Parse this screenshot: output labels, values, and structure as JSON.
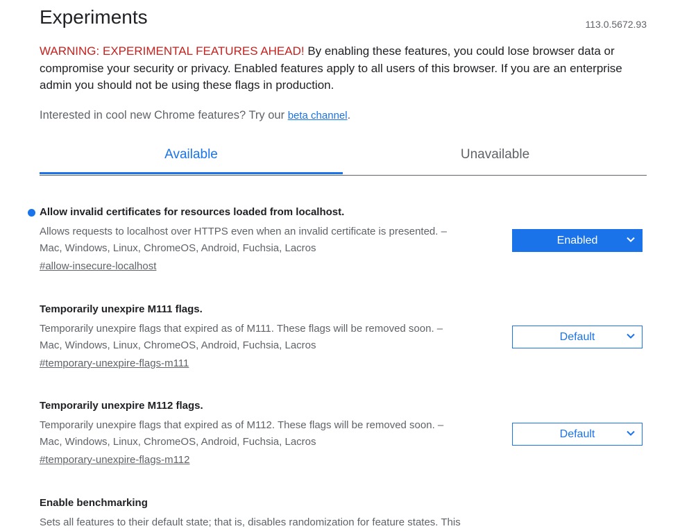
{
  "header": {
    "title": "Experiments",
    "version": "113.0.5672.93"
  },
  "warning": {
    "label": "WARNING: EXPERIMENTAL FEATURES AHEAD!",
    "text": " By enabling these features, you could lose browser data or compromise your security or privacy. Enabled features apply to all users of this browser. If you are an enterprise admin you should not be using these flags in production."
  },
  "promo": {
    "text": "Interested in cool new Chrome features? Try our ",
    "link": "beta channel",
    "suffix": "."
  },
  "tabs": [
    {
      "label": "Available",
      "active": true
    },
    {
      "label": "Unavailable",
      "active": false
    }
  ],
  "flags": [
    {
      "name": "Allow invalid certificates for resources loaded from localhost.",
      "description_line1": "Allows requests to localhost over HTTPS even when an invalid certificate is presented. –",
      "description_line2": "Mac, Windows, Linux, ChromeOS, Android, Fuchsia, Lacros",
      "link": "#allow-insecure-localhost",
      "value": "Enabled",
      "modified": true
    },
    {
      "name": "Temporarily unexpire M111 flags.",
      "description_line1": "Temporarily unexpire flags that expired as of M111. These flags will be removed soon. –",
      "description_line2": "Mac, Windows, Linux, ChromeOS, Android, Fuchsia, Lacros",
      "link": "#temporary-unexpire-flags-m111",
      "value": "Default",
      "modified": false
    },
    {
      "name": "Temporarily unexpire M112 flags.",
      "description_line1": "Temporarily unexpire flags that expired as of M112. These flags will be removed soon. –",
      "description_line2": "Mac, Windows, Linux, ChromeOS, Android, Fuchsia, Lacros",
      "link": "#temporary-unexpire-flags-m112",
      "value": "Default",
      "modified": false
    },
    {
      "name": "Enable benchmarking",
      "description_line1": "Sets all features to their default state; that is, disables randomization for feature states. This"
    }
  ],
  "colors": {
    "accent": "#1a73e8",
    "warning": "#c5221f",
    "secondary_text": "#5f6368"
  },
  "icons": {
    "modified_indicator": "blue-dot-icon",
    "dropdown": "chevron-down-icon"
  }
}
